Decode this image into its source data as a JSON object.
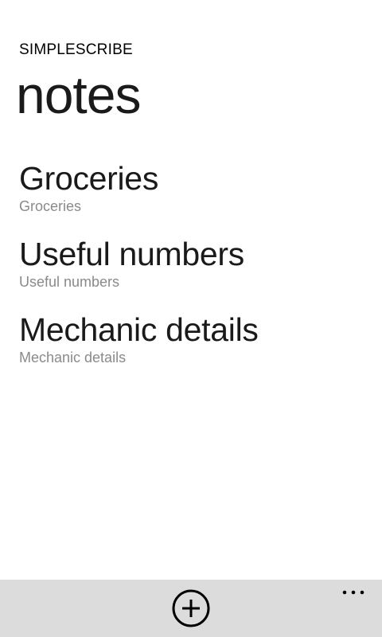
{
  "app": {
    "title": "SIMPLESCRIBE"
  },
  "page": {
    "title": "notes"
  },
  "notes": [
    {
      "title": "Groceries",
      "preview": "Groceries"
    },
    {
      "title": "Useful numbers",
      "preview": "Useful numbers"
    },
    {
      "title": "Mechanic details",
      "preview": "Mechanic details"
    }
  ],
  "app_bar": {
    "add_icon": "add-circle-icon",
    "more_icon": "ellipsis-icon"
  },
  "colors": {
    "background": "#ffffff",
    "app_bar": "#dcdcdc",
    "primary_text": "#1a1a1a",
    "secondary_text": "#8a8a8a"
  }
}
